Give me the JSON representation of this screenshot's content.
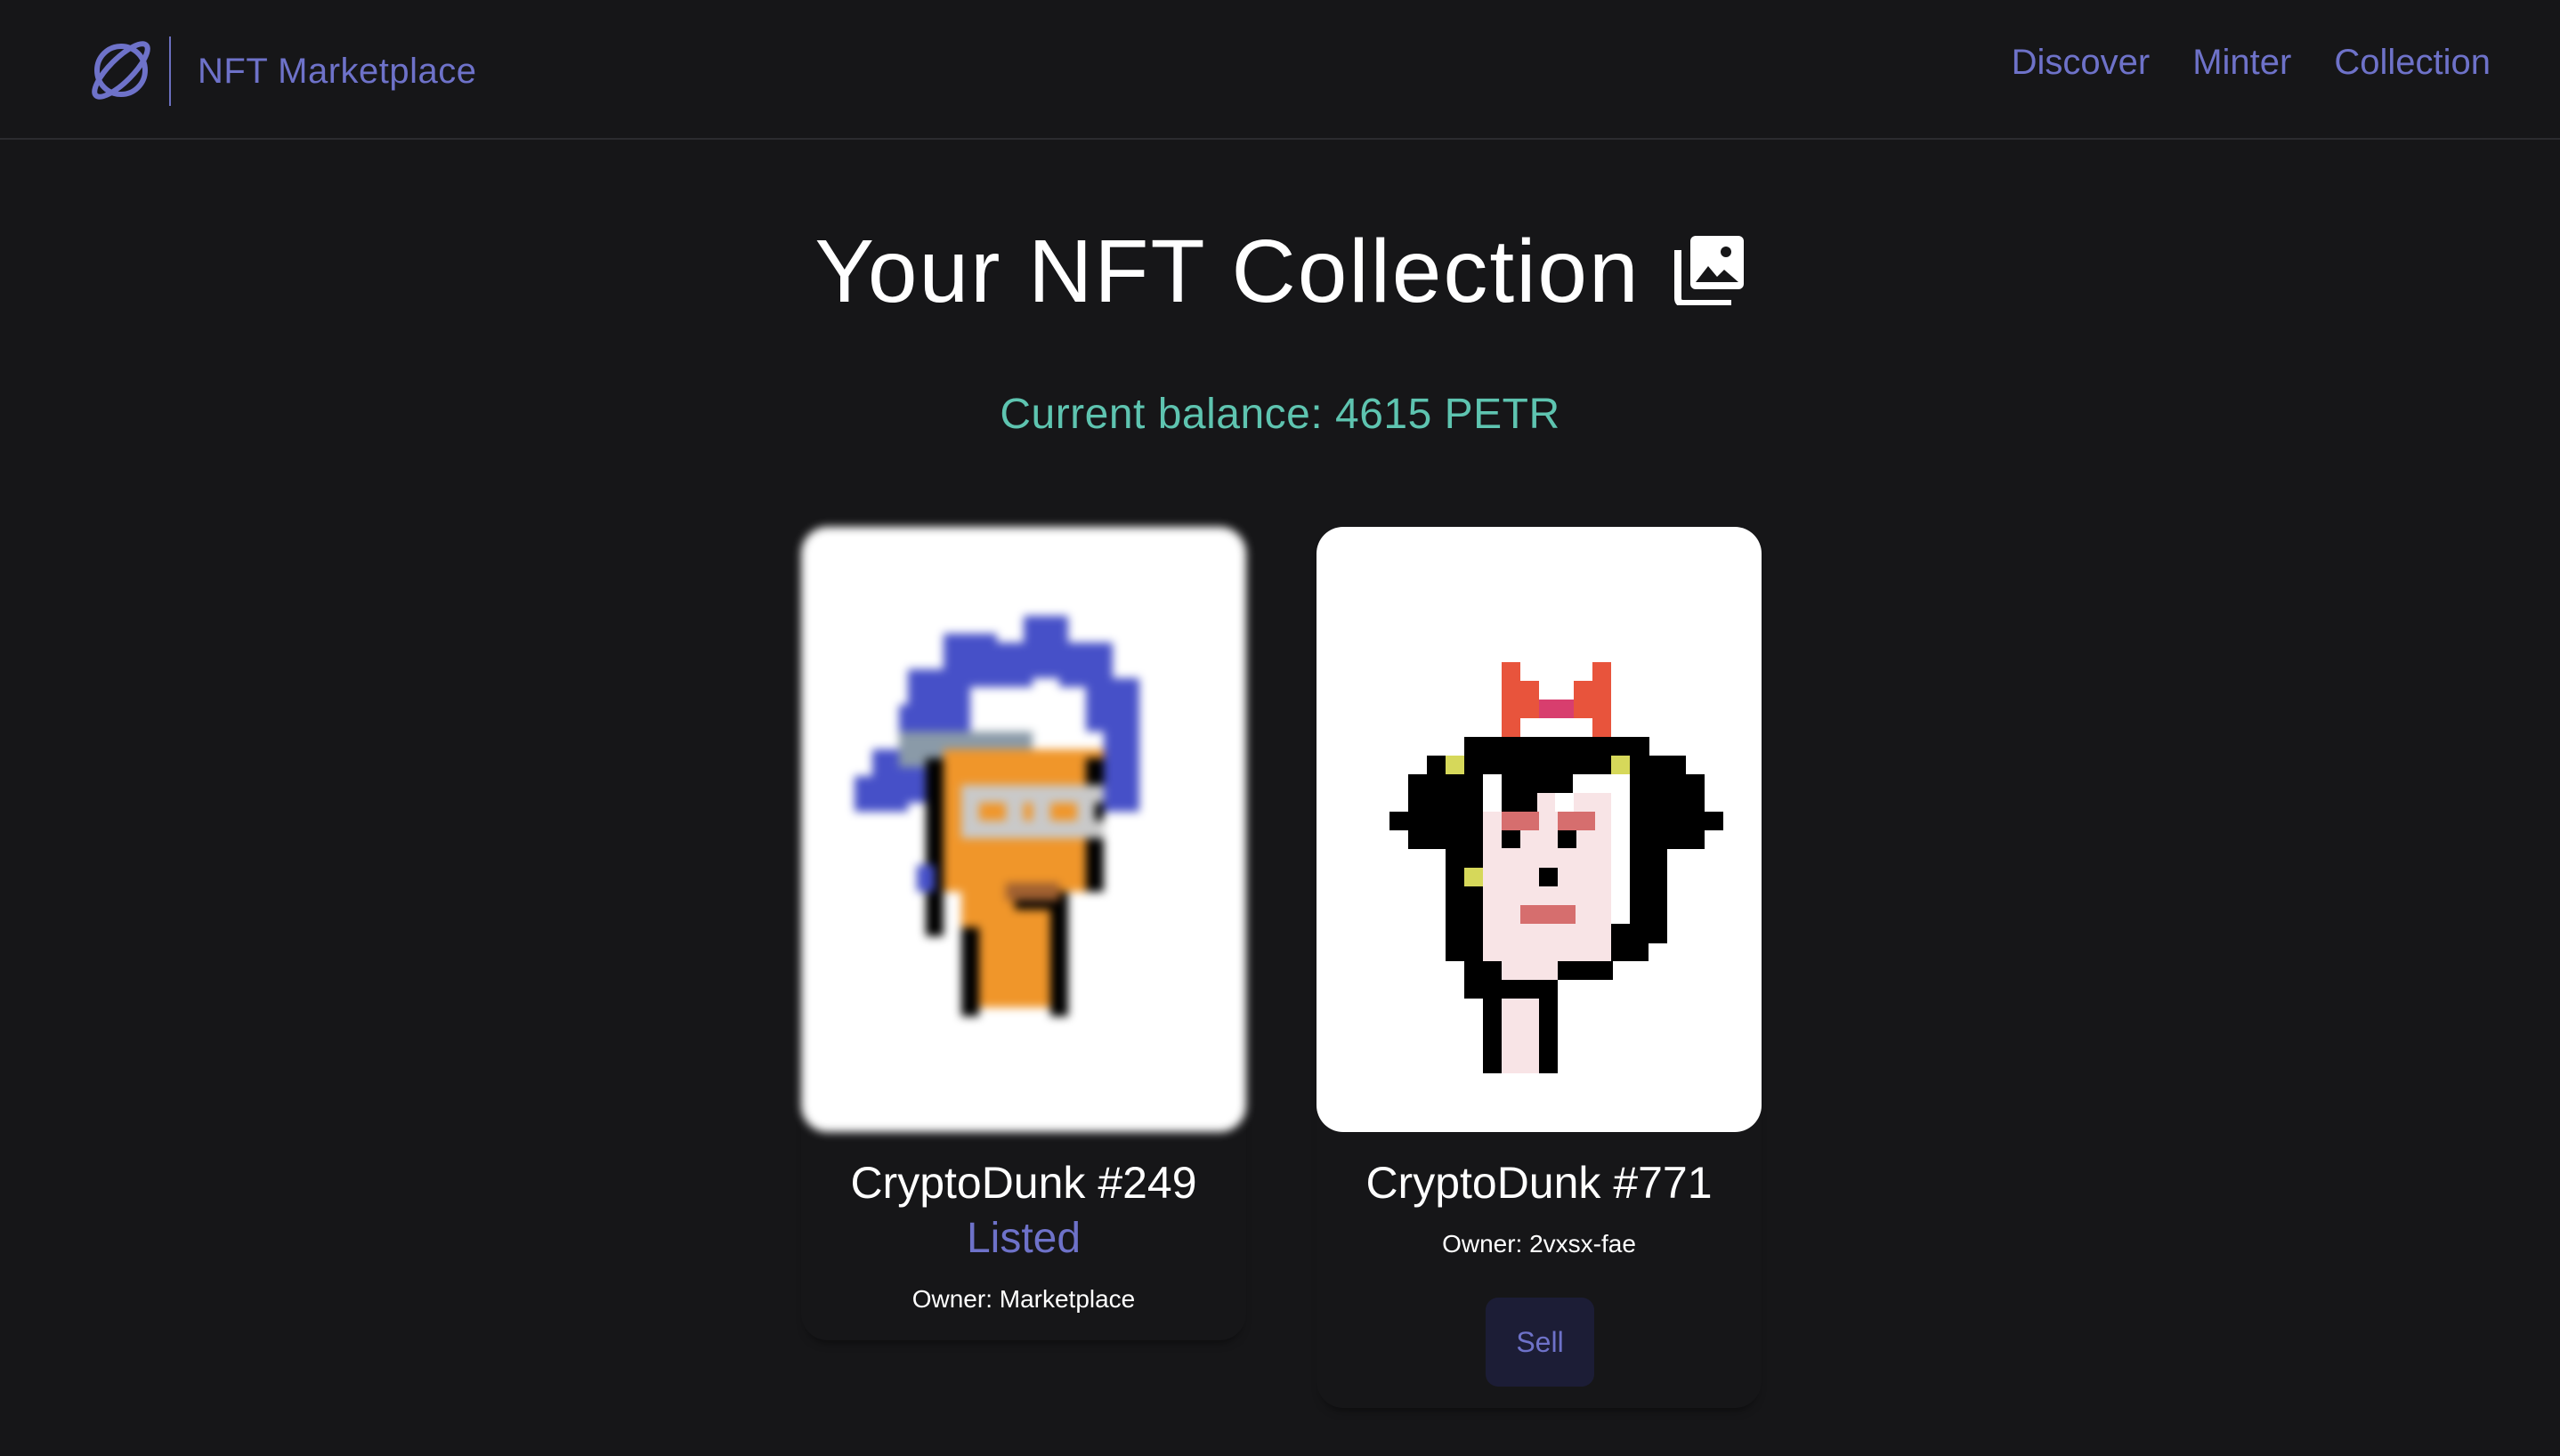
{
  "navbar": {
    "brand_name": "NFT Marketplace",
    "links": [
      "Discover",
      "Minter",
      "Collection"
    ]
  },
  "page": {
    "title": "Your NFT Collection",
    "balance": "Current balance: 4615 PETR"
  },
  "cards": [
    {
      "name": "CryptoDunk #249",
      "status": "Listed",
      "owner": "Owner: Marketplace",
      "image_blurred": true
    },
    {
      "name": "CryptoDunk #771",
      "owner": "Owner: 2vxsx-fae",
      "sell_label": "Sell",
      "image_blurred": false
    }
  ],
  "icons": {
    "brand": "planet-logo-icon",
    "title": "image-gallery-icon"
  },
  "colors": {
    "accent": "#6e72c9",
    "balance": "#5ec4b0",
    "background": "#161618"
  }
}
